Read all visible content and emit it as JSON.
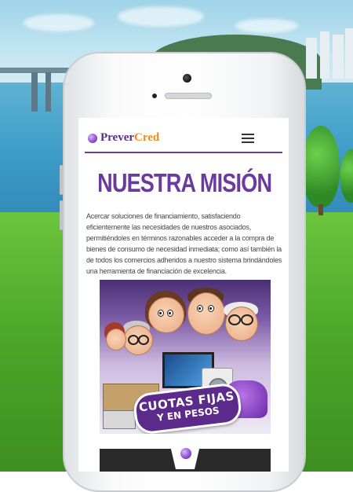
{
  "app": {
    "brand_part1": "Prever",
    "brand_part2": "Cred",
    "menu_icon": "hamburger-menu-icon"
  },
  "content": {
    "title": "NUESTRA MISIÓN",
    "paragraph": "Acercar soluciones de financiamiento, satisfaciendo eficientemente las necesidades de nuestros asociados, permitiéndoles en términos razonables acceder a la compra de bienes de consumo de necesidad inmediata; como así también la de todos los comercios adheridos a nuestro sistema brindándoles una herramienta de financiación de excelencia."
  },
  "promo": {
    "badge_line1": "CUOTAS FIJAS",
    "badge_line2": "Y EN PESOS"
  },
  "colors": {
    "brand_purple": "#5a2d86",
    "brand_orange": "#f08a1c",
    "title_purple": "#6a3a9e"
  }
}
